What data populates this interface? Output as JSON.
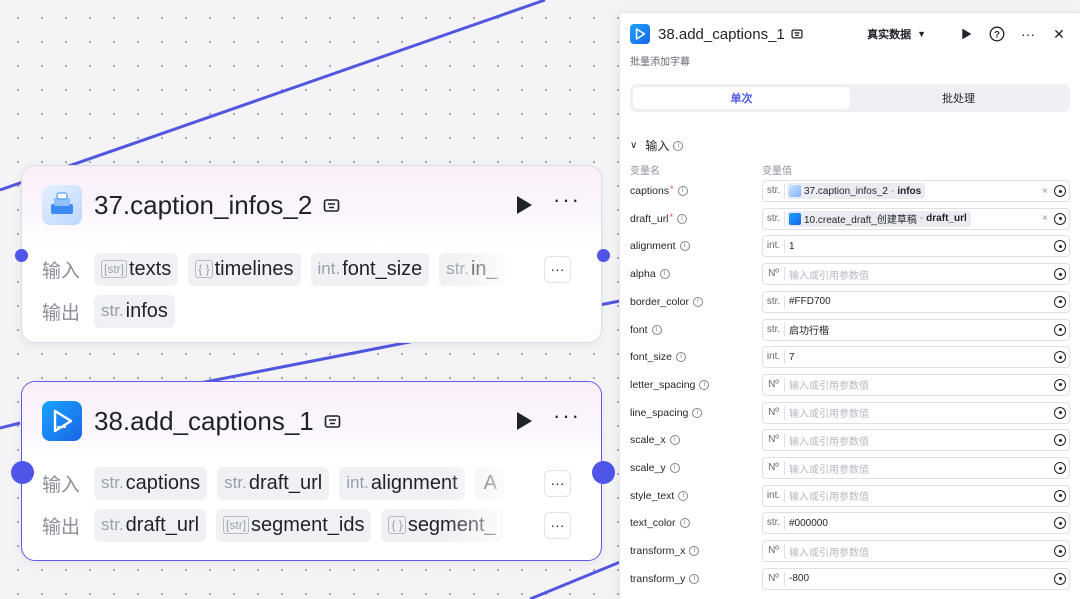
{
  "nodes": [
    {
      "title": "37.caption_infos_2",
      "input_label": "输入",
      "output_label": "输出",
      "inputs": [
        {
          "type": "[str]",
          "name": "texts"
        },
        {
          "type": "{ }",
          "name": "timelines"
        },
        {
          "type": "int.",
          "name": "font_size"
        },
        {
          "type": "str.",
          "name": "in_"
        }
      ],
      "outputs": [
        {
          "type": "str.",
          "name": "infos"
        }
      ],
      "more": "···"
    },
    {
      "title": "38.add_captions_1",
      "input_label": "输入",
      "output_label": "输出",
      "inputs": [
        {
          "type": "str.",
          "name": "captions"
        },
        {
          "type": "str.",
          "name": "draft_url"
        },
        {
          "type": "int.",
          "name": "alignment"
        },
        {
          "type": "",
          "name": "A"
        }
      ],
      "outputs": [
        {
          "type": "str.",
          "name": "draft_url"
        },
        {
          "type": "[str]",
          "name": "segment_ids"
        },
        {
          "type": "{ }",
          "name": "segment_"
        }
      ],
      "more": "···"
    }
  ],
  "panel": {
    "title": "38.add_captions_1",
    "subtitle": "批量添加字幕",
    "mode": "真实数据",
    "mode_caret": "▼",
    "help": "?",
    "more": "···",
    "close": "✕",
    "tabs": [
      {
        "label": "单次",
        "active": true
      },
      {
        "label": "批处理",
        "active": false
      }
    ],
    "section_chevron": "∨",
    "section_title": "输入",
    "col_name": "变量名",
    "col_value": "变量值",
    "params": [
      {
        "name": "captions",
        "required": true,
        "type": "str.",
        "ref": {
          "node": "37.caption_infos_2",
          "var": "infos",
          "icon": "cap"
        }
      },
      {
        "name": "draft_url",
        "required": true,
        "type": "str.",
        "ref": {
          "node": "10.create_draft_创建草稿",
          "var": "draft_url",
          "icon": "drf"
        }
      },
      {
        "name": "alignment",
        "type": "int.",
        "value": "1"
      },
      {
        "name": "alpha",
        "type": "Nº",
        "value": "",
        "placeholder": "输入或引用参数值"
      },
      {
        "name": "border_color",
        "type": "str.",
        "value": "#FFD700"
      },
      {
        "name": "font",
        "type": "str.",
        "value": "启功行楷"
      },
      {
        "name": "font_size",
        "type": "int.",
        "value": "7"
      },
      {
        "name": "letter_spacing",
        "type": "Nº",
        "value": "",
        "placeholder": "输入或引用参数值"
      },
      {
        "name": "line_spacing",
        "type": "Nº",
        "value": "",
        "placeholder": "输入或引用参数值"
      },
      {
        "name": "scale_x",
        "type": "Nº",
        "value": "",
        "placeholder": "输入或引用参数值"
      },
      {
        "name": "scale_y",
        "type": "Nº",
        "value": "",
        "placeholder": "输入或引用参数值"
      },
      {
        "name": "style_text",
        "type": "int.",
        "value": "",
        "placeholder": "输入或引用参数值"
      },
      {
        "name": "text_color",
        "type": "str.",
        "value": "#000000"
      },
      {
        "name": "transform_x",
        "type": "Nº",
        "value": "",
        "placeholder": "输入或引用参数值"
      },
      {
        "name": "transform_y",
        "type": "Nº",
        "value": "-800"
      }
    ],
    "ref_separator": "-",
    "clear_icon": "×"
  },
  "colors": {
    "accent": "#4f55e8",
    "edge": "#5157e0",
    "required": "#f54a45"
  },
  "icons": {
    "node_37": "caption-dataset-icon",
    "node_38": "play-caption-icon",
    "run": "play-icon",
    "param_pick": "target-icon",
    "info": "info-icon"
  }
}
